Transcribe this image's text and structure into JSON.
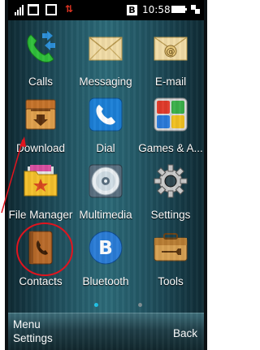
{
  "status_bar": {
    "time": "10:58",
    "updown_glyph": "⇅",
    "badge_letter": "B"
  },
  "apps": [
    {
      "label": "Calls",
      "icon": "calls-icon"
    },
    {
      "label": "Messaging",
      "icon": "envelope-icon"
    },
    {
      "label": "E-mail",
      "icon": "email-icon"
    },
    {
      "label": "Download",
      "icon": "download-box-icon"
    },
    {
      "label": "Dial",
      "icon": "phone-handset-icon"
    },
    {
      "label": "Games & A...",
      "icon": "games-tiles-icon"
    },
    {
      "label": "File Manager",
      "icon": "folder-star-icon"
    },
    {
      "label": "Multimedia",
      "icon": "cd-disc-icon"
    },
    {
      "label": "Settings",
      "icon": "gear-icon"
    },
    {
      "label": "Contacts",
      "icon": "contacts-book-icon"
    },
    {
      "label": "Bluetooth",
      "icon": "bluetooth-icon"
    },
    {
      "label": "Tools",
      "icon": "toolbox-icon"
    }
  ],
  "page_indicator": {
    "current": 1,
    "total": 2
  },
  "softkeys": {
    "left_top": "Menu",
    "left_bottom": "Settings",
    "right": "Back"
  },
  "colors": {
    "annotation": "#e0141e",
    "active_dot": "#1fc4e8",
    "inactive_dot": "#7a8a8f"
  }
}
